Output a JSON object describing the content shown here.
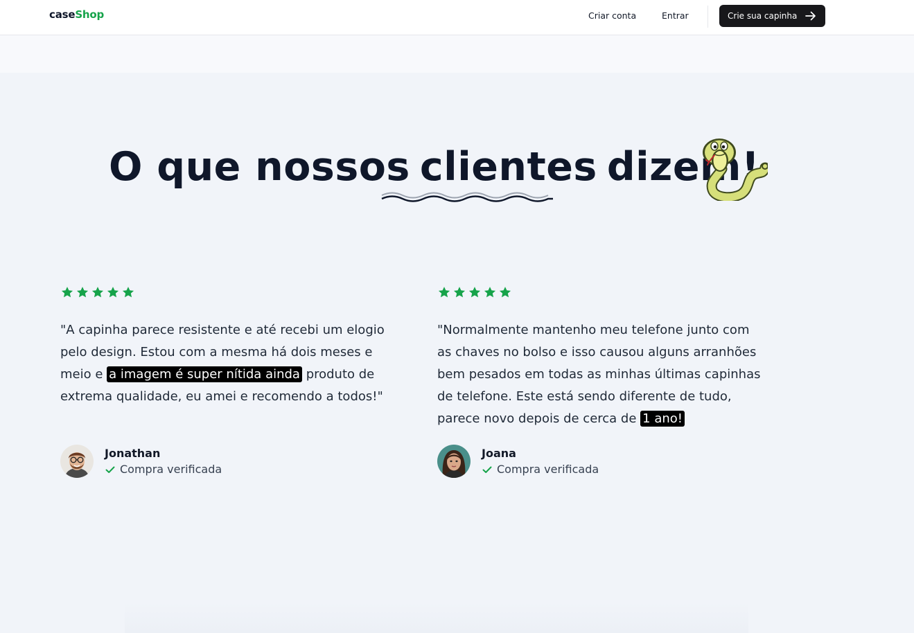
{
  "navbar": {
    "logo_part1": "case",
    "logo_part2": "Shop",
    "signup_label": "Criar conta",
    "login_label": "Entrar",
    "cta_label": "Crie sua capinha"
  },
  "headline": {
    "part1": "O que nossos",
    "highlight": "clientes",
    "part2": "dizem!"
  },
  "reviews": [
    {
      "rating": 5,
      "text_before": "\"A capinha parece resistente e até recebi um elogio pelo design. Estou com a mesma há dois meses e meio e ",
      "text_highlight": "a imagem é super nítida ainda",
      "text_after": " produto de extrema qualidade, eu amei e recomendo a todos!\"",
      "author": "Jonathan",
      "verified_label": "Compra verificada"
    },
    {
      "rating": 5,
      "text_before": "\"Normalmente mantenho meu telefone junto com as chaves no bolso e isso causou alguns arranhões bem pesados em todas as minhas últimas capinhas de telefone. Este está sendo diferente de tudo, parece novo depois de cerca de ",
      "text_highlight": "1 ano!",
      "text_after": "",
      "author": "Joana",
      "verified_label": "Compra verificada"
    }
  ],
  "colors": {
    "brand_green": "#16a34a",
    "star_green": "#16a34a",
    "dark": "#0f172a",
    "background": "#f1f4f9"
  }
}
